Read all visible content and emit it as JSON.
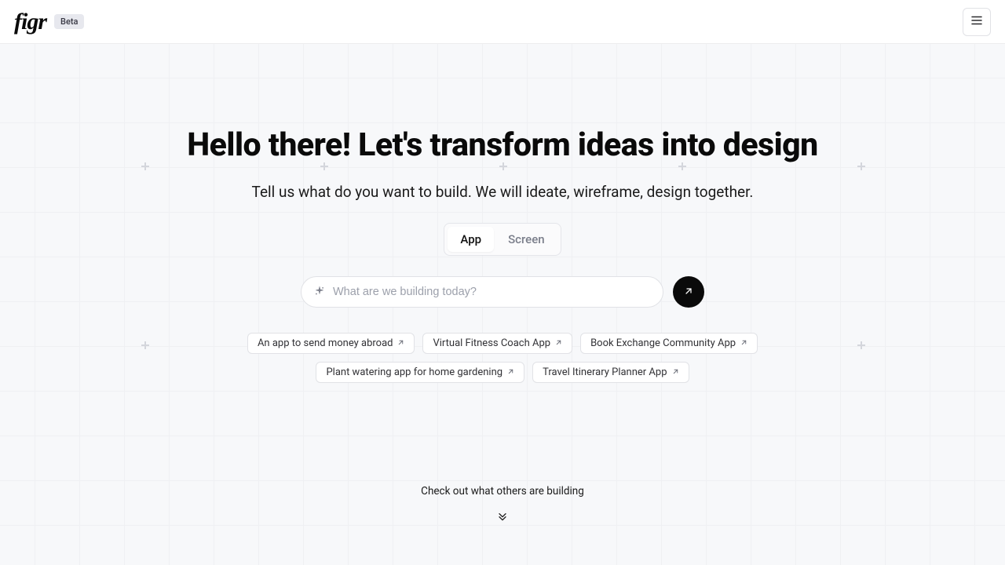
{
  "header": {
    "logo_text": "figr",
    "badge_label": "Beta"
  },
  "hero": {
    "headline": "Hello there! Let's transform ideas into design",
    "subheadline": "Tell us what do you want to build. We will ideate, wireframe, design together."
  },
  "segmented": {
    "items": [
      "App",
      "Screen"
    ],
    "active_index": 0
  },
  "prompt": {
    "placeholder": "What are we building today?",
    "value": ""
  },
  "suggestions": [
    "An app to send money abroad",
    "Virtual Fitness Coach App",
    "Book Exchange Community App",
    "Plant watering app for home gardening",
    "Travel Itinerary Planner App"
  ],
  "footer": {
    "cta_text": "Check out what others are building"
  },
  "colors": {
    "page_bg": "#f7f8fa",
    "header_bg": "#ffffff",
    "border": "#e1e2e6",
    "text_primary": "#0a0a0a",
    "text_muted": "#9ca0ab",
    "submit_bg": "#0a0a0a"
  }
}
